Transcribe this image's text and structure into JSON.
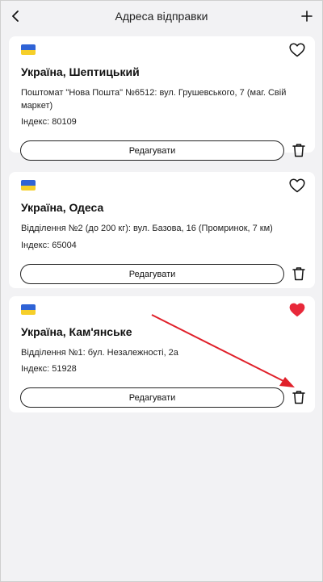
{
  "header": {
    "title": "Адреса відправки"
  },
  "addresses": [
    {
      "city": "Україна, Шептицький",
      "address": "Поштомат \"Нова Пошта\" №6512: вул. Грушевського, 7 (маг. Свій маркет)",
      "index": "Індекс: 80109",
      "edit_label": "Редагувати",
      "favorite": false
    },
    {
      "city": "Україна, Одеса",
      "address": "Відділення №2 (до 200 кг): вул. Базова, 16 (Промринок, 7 км)",
      "index": "Індекс: 65004",
      "edit_label": "Редагувати",
      "favorite": false
    },
    {
      "city": "Україна, Кам'янське",
      "address": "Відділення №1: бул. Незалежності, 2а",
      "index": "Індекс: 51928",
      "edit_label": "Редагувати",
      "favorite": true
    }
  ],
  "icons": {
    "back": "chevron-left-icon",
    "add": "plus-icon",
    "flag": "ukraine-flag-icon",
    "heart": "heart-icon",
    "trash": "trash-icon"
  },
  "colors": {
    "background": "#f2f2f4",
    "card": "#ffffff",
    "favorite": "#e8283a",
    "flag_blue": "#2f63d6",
    "flag_yellow": "#f6cf2a",
    "annotation_arrow": "#e0202a"
  }
}
